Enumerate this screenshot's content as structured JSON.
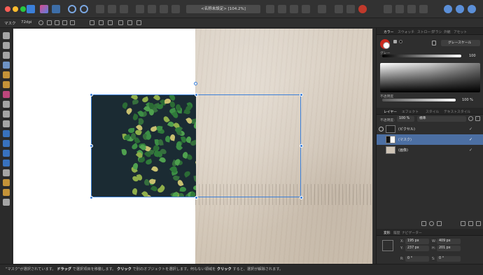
{
  "titlebar": {
    "document_title": "<名称未設定> [104.2%]",
    "colors": {
      "close": "#ff5f57",
      "minimize": "#febc2e",
      "maximize": "#28c840",
      "accent": "#3b7fd8"
    }
  },
  "context_toolbar": {
    "mode_label": "マスク",
    "dpi_label": "72dpi"
  },
  "tools": [
    "move-tool",
    "node-tool",
    "frame-text-tool",
    "pen-tool",
    "pencil-tool",
    "vector-brush-tool",
    "fill-tool",
    "transparency-tool",
    "crop-tool",
    "place-image-tool",
    "rectangle-tool",
    "ellipse-tool",
    "rounded-rectangle-tool",
    "star-tool",
    "artistic-text-tool",
    "color-picker-tool",
    "view-tool",
    "zoom-tool"
  ],
  "color_panel": {
    "tabs": [
      "カラー",
      "スウォッチ",
      "ストローク",
      "ブラシ",
      "外観",
      "アセット"
    ],
    "active_tab": "カラー",
    "mode": "グレースケール",
    "gray_label": "グレー",
    "gray_value": "100",
    "opacity_label": "不透明度",
    "opacity_value": "100 %",
    "fill_color": "#cc2a1f",
    "stroke_color": "#ffffff"
  },
  "layers_panel": {
    "tabs": [
      "レイヤー",
      "エフェクト",
      "スタイル",
      "テキストスタイル"
    ],
    "active_tab": "レイヤー",
    "opacity_label": "不透明度:",
    "opacity_value": "100 %",
    "blend_mode": "標準",
    "layers": [
      {
        "name": "(ピクセル)",
        "selected": false
      },
      {
        "name": "(マスク)",
        "selected": true
      },
      {
        "name": "(画像)",
        "selected": false
      }
    ]
  },
  "transform_panel": {
    "tabs": [
      "変形",
      "履歴",
      "ナビゲーター"
    ],
    "active_tab": "変形",
    "x_label": "X:",
    "x_value": "195 px",
    "y_label": "Y:",
    "y_value": "237 px",
    "w_label": "W:",
    "w_value": "409 px",
    "h_label": "H:",
    "h_value": "201 px",
    "r_label": "R:",
    "r_value": "0 °",
    "s_label": "S:",
    "s_value": "0 °"
  },
  "status": {
    "part1": "\"マスク\"が選択されています。",
    "part2": "ドラッグ",
    "part3": "で選択項目を移動します。",
    "part4": "クリック",
    "part5": "で別のオブジェクトを選択します。何もない領域を",
    "part6": "クリック",
    "part7": "すると、選択が解除されます。"
  }
}
